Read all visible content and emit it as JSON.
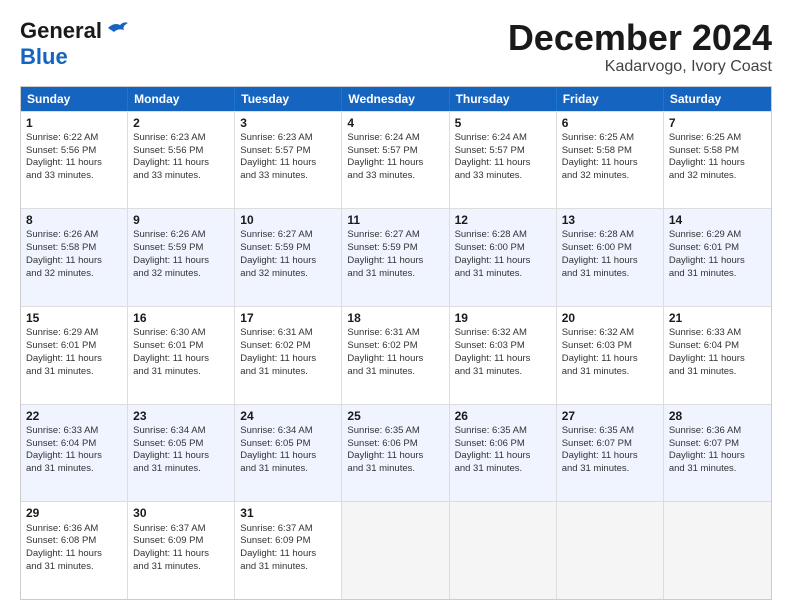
{
  "logo": {
    "line1": "General",
    "line2": "Blue"
  },
  "title": "December 2024",
  "subtitle": "Kadarvogo, Ivory Coast",
  "days": [
    "Sunday",
    "Monday",
    "Tuesday",
    "Wednesday",
    "Thursday",
    "Friday",
    "Saturday"
  ],
  "rows": [
    {
      "alt": false,
      "cells": [
        {
          "day": "1",
          "info": "Sunrise: 6:22 AM\nSunset: 5:56 PM\nDaylight: 11 hours\nand 33 minutes."
        },
        {
          "day": "2",
          "info": "Sunrise: 6:23 AM\nSunset: 5:56 PM\nDaylight: 11 hours\nand 33 minutes."
        },
        {
          "day": "3",
          "info": "Sunrise: 6:23 AM\nSunset: 5:57 PM\nDaylight: 11 hours\nand 33 minutes."
        },
        {
          "day": "4",
          "info": "Sunrise: 6:24 AM\nSunset: 5:57 PM\nDaylight: 11 hours\nand 33 minutes."
        },
        {
          "day": "5",
          "info": "Sunrise: 6:24 AM\nSunset: 5:57 PM\nDaylight: 11 hours\nand 33 minutes."
        },
        {
          "day": "6",
          "info": "Sunrise: 6:25 AM\nSunset: 5:58 PM\nDaylight: 11 hours\nand 32 minutes."
        },
        {
          "day": "7",
          "info": "Sunrise: 6:25 AM\nSunset: 5:58 PM\nDaylight: 11 hours\nand 32 minutes."
        }
      ]
    },
    {
      "alt": true,
      "cells": [
        {
          "day": "8",
          "info": "Sunrise: 6:26 AM\nSunset: 5:58 PM\nDaylight: 11 hours\nand 32 minutes."
        },
        {
          "day": "9",
          "info": "Sunrise: 6:26 AM\nSunset: 5:59 PM\nDaylight: 11 hours\nand 32 minutes."
        },
        {
          "day": "10",
          "info": "Sunrise: 6:27 AM\nSunset: 5:59 PM\nDaylight: 11 hours\nand 32 minutes."
        },
        {
          "day": "11",
          "info": "Sunrise: 6:27 AM\nSunset: 5:59 PM\nDaylight: 11 hours\nand 31 minutes."
        },
        {
          "day": "12",
          "info": "Sunrise: 6:28 AM\nSunset: 6:00 PM\nDaylight: 11 hours\nand 31 minutes."
        },
        {
          "day": "13",
          "info": "Sunrise: 6:28 AM\nSunset: 6:00 PM\nDaylight: 11 hours\nand 31 minutes."
        },
        {
          "day": "14",
          "info": "Sunrise: 6:29 AM\nSunset: 6:01 PM\nDaylight: 11 hours\nand 31 minutes."
        }
      ]
    },
    {
      "alt": false,
      "cells": [
        {
          "day": "15",
          "info": "Sunrise: 6:29 AM\nSunset: 6:01 PM\nDaylight: 11 hours\nand 31 minutes."
        },
        {
          "day": "16",
          "info": "Sunrise: 6:30 AM\nSunset: 6:01 PM\nDaylight: 11 hours\nand 31 minutes."
        },
        {
          "day": "17",
          "info": "Sunrise: 6:31 AM\nSunset: 6:02 PM\nDaylight: 11 hours\nand 31 minutes."
        },
        {
          "day": "18",
          "info": "Sunrise: 6:31 AM\nSunset: 6:02 PM\nDaylight: 11 hours\nand 31 minutes."
        },
        {
          "day": "19",
          "info": "Sunrise: 6:32 AM\nSunset: 6:03 PM\nDaylight: 11 hours\nand 31 minutes."
        },
        {
          "day": "20",
          "info": "Sunrise: 6:32 AM\nSunset: 6:03 PM\nDaylight: 11 hours\nand 31 minutes."
        },
        {
          "day": "21",
          "info": "Sunrise: 6:33 AM\nSunset: 6:04 PM\nDaylight: 11 hours\nand 31 minutes."
        }
      ]
    },
    {
      "alt": true,
      "cells": [
        {
          "day": "22",
          "info": "Sunrise: 6:33 AM\nSunset: 6:04 PM\nDaylight: 11 hours\nand 31 minutes."
        },
        {
          "day": "23",
          "info": "Sunrise: 6:34 AM\nSunset: 6:05 PM\nDaylight: 11 hours\nand 31 minutes."
        },
        {
          "day": "24",
          "info": "Sunrise: 6:34 AM\nSunset: 6:05 PM\nDaylight: 11 hours\nand 31 minutes."
        },
        {
          "day": "25",
          "info": "Sunrise: 6:35 AM\nSunset: 6:06 PM\nDaylight: 11 hours\nand 31 minutes."
        },
        {
          "day": "26",
          "info": "Sunrise: 6:35 AM\nSunset: 6:06 PM\nDaylight: 11 hours\nand 31 minutes."
        },
        {
          "day": "27",
          "info": "Sunrise: 6:35 AM\nSunset: 6:07 PM\nDaylight: 11 hours\nand 31 minutes."
        },
        {
          "day": "28",
          "info": "Sunrise: 6:36 AM\nSunset: 6:07 PM\nDaylight: 11 hours\nand 31 minutes."
        }
      ]
    },
    {
      "alt": false,
      "cells": [
        {
          "day": "29",
          "info": "Sunrise: 6:36 AM\nSunset: 6:08 PM\nDaylight: 11 hours\nand 31 minutes."
        },
        {
          "day": "30",
          "info": "Sunrise: 6:37 AM\nSunset: 6:09 PM\nDaylight: 11 hours\nand 31 minutes."
        },
        {
          "day": "31",
          "info": "Sunrise: 6:37 AM\nSunset: 6:09 PM\nDaylight: 11 hours\nand 31 minutes."
        },
        {
          "day": "",
          "info": ""
        },
        {
          "day": "",
          "info": ""
        },
        {
          "day": "",
          "info": ""
        },
        {
          "day": "",
          "info": ""
        }
      ]
    }
  ]
}
